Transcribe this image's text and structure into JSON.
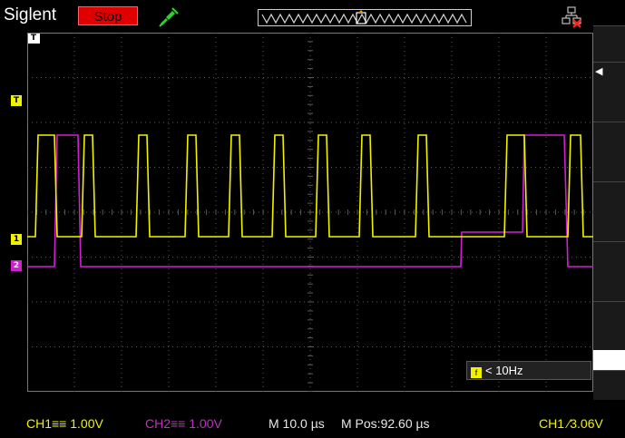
{
  "header": {
    "brand": "Siglent",
    "run_state_label": "Stop",
    "trigger_icon": "probe-icon",
    "memory_icon": "zigzag-timebase-icon",
    "network_icon": "network-disconnected-icon"
  },
  "markers": {
    "trigger_level": "T",
    "ch1": "1",
    "ch2": "2",
    "trigger_position": "T"
  },
  "freq_counter": {
    "icon_label": "f",
    "text": "< 10Hz"
  },
  "status": {
    "ch1": "CH1≡≡ 1.00V",
    "ch2": "CH2≡≡ 1.00V",
    "timebase": "M 10.0 µs",
    "position": "M Pos:92.60 µs",
    "trigger": "CH1 ∕3.06V"
  },
  "colors": {
    "ch1": "#f2f200",
    "ch2": "#d020d0",
    "stop": "#e00000",
    "grid": "#6a6a6a"
  }
}
